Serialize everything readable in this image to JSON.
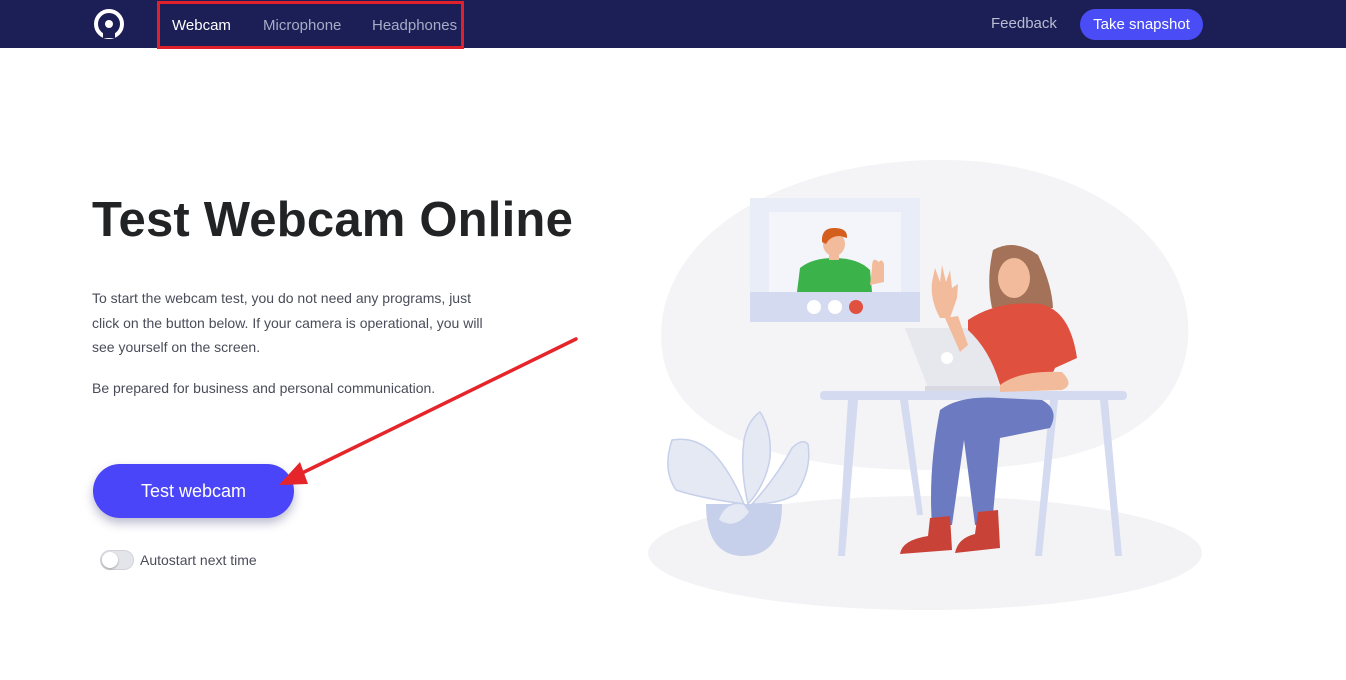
{
  "nav": {
    "logo_icon": "webcam-logo-icon",
    "tabs": [
      {
        "label": "Webcam",
        "active": true
      },
      {
        "label": "Microphone",
        "active": false
      },
      {
        "label": "Headphones",
        "active": false
      }
    ],
    "feedback_label": "Feedback",
    "snapshot_label": "Take snapshot"
  },
  "hero": {
    "title": "Test Webcam Online",
    "intro": "To start the webcam test, you do not need any programs, just click on the button below. If your camera is operational, you will see yourself on the screen.",
    "secondary": "Be prepared for business and personal communication.",
    "test_button_label": "Test webcam",
    "autostart_label": "Autostart next time",
    "autostart_on": false
  },
  "colors": {
    "navbar_bg": "#1b1f55",
    "accent": "#4a45f8",
    "highlight_red": "#e0212b"
  }
}
